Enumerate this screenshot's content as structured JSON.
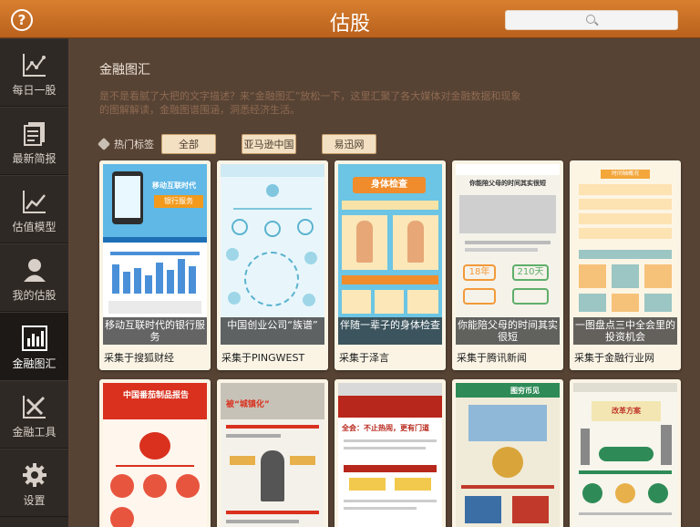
{
  "header": {
    "title": "估股",
    "search_placeholder": ""
  },
  "sidebar": {
    "items": [
      {
        "label": "每日一股",
        "icon": "chart-line-icon"
      },
      {
        "label": "最新简报",
        "icon": "document-icon"
      },
      {
        "label": "估值模型",
        "icon": "trend-icon"
      },
      {
        "label": "我的估股",
        "icon": "user-icon"
      },
      {
        "label": "金融图汇",
        "icon": "bar-chart-icon"
      },
      {
        "label": "金融工具",
        "icon": "tools-icon"
      },
      {
        "label": "设置",
        "icon": "gear-icon"
      }
    ],
    "active": 4
  },
  "main": {
    "title": "金融图汇",
    "description": "是不是看腻了大把的文字描述？来“金融图汇”放松一下，这里汇聚了各大媒体对金融数据和现象的图解解读，金融图谱围涵，洞悉经济生活。",
    "tags_label": "热门标签",
    "tags": [
      "全部",
      "亚马逊中国",
      "易迅网"
    ]
  },
  "cards": [
    {
      "caption": "移动互联时代的银行服务",
      "source": "采集于搜狐财经"
    },
    {
      "caption": "中国创业公司“族谱”",
      "source": "采集于PINGWEST"
    },
    {
      "caption": "伴随一辈子的身体检查",
      "source": "采集于泽言"
    },
    {
      "caption": "你能陪父母的时间其实很短",
      "source": "采集于腾讯新闻"
    },
    {
      "caption": "一图盘点三中全会里的投资机会",
      "source": "采集于金融行业网"
    }
  ],
  "thumb_text": {
    "c1_banner": "移动互联时代",
    "c1_sub": "银行服务",
    "c3_title": "身体检查",
    "c4_title": "你能陪父母的时间其实很短",
    "c4_a": "18年",
    "c4_b": "210天",
    "c5_title": "时间轴概况",
    "r2c1_title": "中国番茄制品报告",
    "r2c2_title": "被“城镇化”",
    "r2c3_title": "全会：不止热闹，更有门道",
    "r2c4_title": "图穷币见",
    "r2c5_title": "改革方案"
  }
}
